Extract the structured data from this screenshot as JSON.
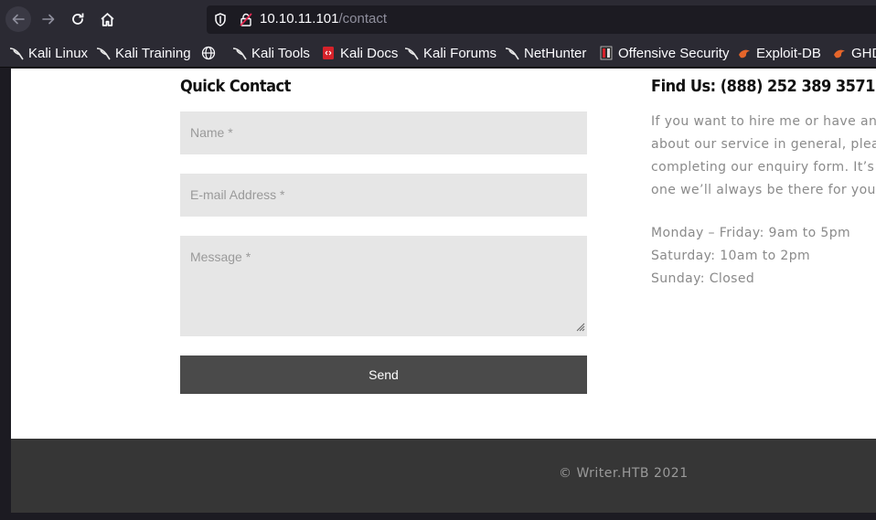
{
  "browser": {
    "url_host": "10.10.11.101",
    "url_path": "/contact"
  },
  "bookmarks": [
    {
      "label": "Kali Linux",
      "icon": "kali-dragon-icon"
    },
    {
      "label": "Kali Training",
      "icon": "kali-dragon-icon"
    },
    {
      "label": "",
      "icon": "globe-icon"
    },
    {
      "label": "Kali Tools",
      "icon": "kali-dragon-icon"
    },
    {
      "label": "Kali Docs",
      "icon": "kali-docs-icon"
    },
    {
      "label": "Kali Forums",
      "icon": "kali-dragon-icon"
    },
    {
      "label": "NetHunter",
      "icon": "kali-dragon-icon"
    },
    {
      "label": "Offensive Security",
      "icon": "offsec-icon"
    },
    {
      "label": "Exploit-DB",
      "icon": "exploitdb-icon"
    },
    {
      "label": "GHD",
      "icon": "exploitdb-icon"
    }
  ],
  "contact": {
    "heading": "Quick Contact",
    "name_placeholder": "Name *",
    "email_placeholder": "E-mail Address *",
    "message_placeholder": "Message *",
    "send_label": "Send"
  },
  "find": {
    "heading": "Find Us: (888) 252 389 3571",
    "intro_lines": [
      "If you want to hire me or have any",
      "about our service in general, pleas",
      "completing our enquiry form. It’s b",
      "one we’ll always be there for you."
    ],
    "hours_lines": [
      "Monday – Friday: 9am to 5pm",
      "Saturday: 10am to 2pm",
      "Sunday: Closed"
    ]
  },
  "footer": {
    "copyright": "© Writer.HTB 2021"
  }
}
